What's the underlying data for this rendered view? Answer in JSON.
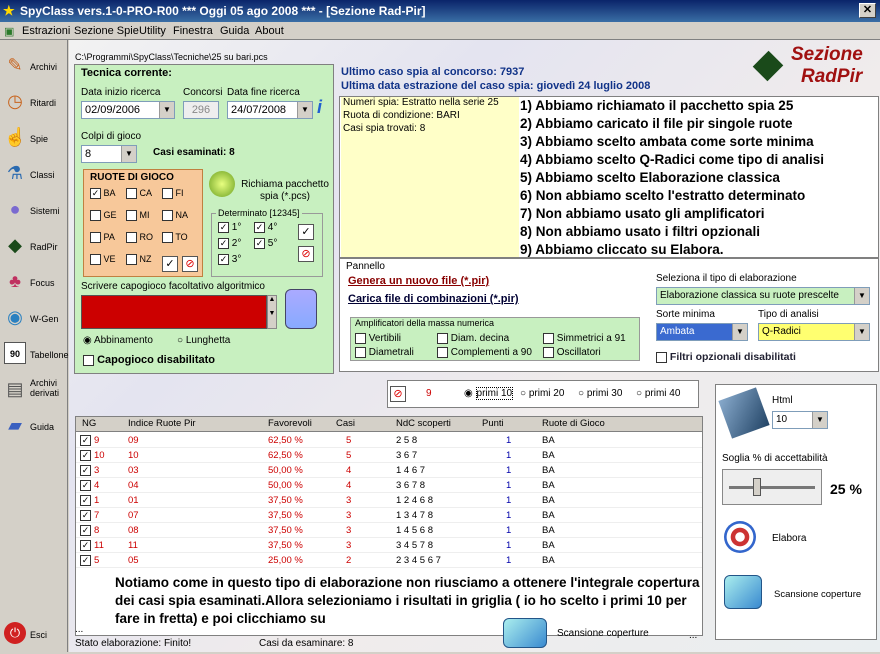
{
  "titlebar": {
    "title": "SpyClass vers.1-0-PRO-R00  ***  Oggi 05 ago 2008  ***   - [Sezione Rad-Pir]",
    "close": "✕"
  },
  "menu": [
    "Estrazioni",
    "Sezione Spie",
    "Utility",
    "Finestra",
    "Guida",
    "About"
  ],
  "sidebar": [
    {
      "label": "Archivi",
      "icon": "✎"
    },
    {
      "label": "Ritardi",
      "icon": "◷"
    },
    {
      "label": "Spie",
      "icon": "☝"
    },
    {
      "label": "Classi",
      "icon": "⚗"
    },
    {
      "label": "Sistemi",
      "icon": "●"
    },
    {
      "label": "RadPir",
      "icon": "◆"
    },
    {
      "label": "Focus",
      "icon": "♣"
    },
    {
      "label": "W-Gen",
      "icon": "◉"
    },
    {
      "label": "Tabellone",
      "icon": "90"
    },
    {
      "label": "Archivi derivati",
      "icon": "▤"
    },
    {
      "label": "Guida",
      "icon": "▰"
    },
    {
      "label": "Esci",
      "icon": "⏻"
    }
  ],
  "path": "C:\\Programmi\\SpyClass\\Tecniche\\25 su bari.pcs",
  "tecnica": {
    "title": "Tecnica corrente:",
    "data_inizio_label": "Data inizio ricerca",
    "data_inizio": "02/09/2006",
    "concorsi_label": "Concorsi",
    "concorsi": "296",
    "data_fine_label": "Data fine ricerca",
    "data_fine": "24/07/2008",
    "colpi_label": "Colpi di gioco",
    "colpi": "8",
    "casi_esaminati": "Casi esaminati: 8"
  },
  "ruote": {
    "title": "RUOTE DI GIOCO",
    "items": [
      {
        "n": "BA",
        "c": true
      },
      {
        "n": "CA",
        "c": false
      },
      {
        "n": "FI",
        "c": false
      },
      {
        "n": "GE",
        "c": false
      },
      {
        "n": "MI",
        "c": false
      },
      {
        "n": "NA",
        "c": false
      },
      {
        "n": "PA",
        "c": false
      },
      {
        "n": "RO",
        "c": false
      },
      {
        "n": "TO",
        "c": false
      },
      {
        "n": "VE",
        "c": false
      },
      {
        "n": "NZ",
        "c": false
      }
    ]
  },
  "richiama": "Richiama pacchetto spia (*.pcs)",
  "determinato": {
    "title": "Determinato [12345]",
    "items": [
      "1°",
      "4°",
      "2°",
      "5°",
      "3°"
    ]
  },
  "capogioco": {
    "label": "Scrivere capogioco facoltativo algoritmico",
    "abbinamento": "Abbinamento",
    "lunghetta": "Lunghetta",
    "disabilitato": "Capogioco disabilitato"
  },
  "header_info": {
    "ultimo_caso": "Ultimo caso spia al concorso: 7937",
    "ultima_data": "Ultima data estrazione del caso spia: giovedì 24 luglio 2008"
  },
  "logo": {
    "line1": "Sezione",
    "line2": "RadPir"
  },
  "info_box": [
    "Numeri spia: Estratto nella serie 25",
    "Ruota di condizione: BARI",
    "Casi spia trovati: 8"
  ],
  "instructions": [
    "1) Abbiamo richiamato il pacchetto spia 25",
    "2) Abbiamo caricato il file pir singole ruote",
    "3) Abbiamo scelto ambata come sorte minima",
    "4) Abbiamo scelto Q-Radici come tipo di analisi",
    "5) Abbiamo scelto Elaborazione classica",
    "6) Non abbiamo scelto l'estratto determinato",
    "7) Non abbiamo usato gli amplificatori",
    "8) Non abbiamo usato i filtri opzionali",
    "9) Abbiamo cliccato su Elabora."
  ],
  "pannello": {
    "title": "Pannello",
    "genera": "Genera un nuovo file  (*.pir)",
    "carica": "Carica file di combinazioni  (*.pir)",
    "amp_title": "Amplificatori della massa numerica",
    "amp": [
      "Vertibili",
      "Diam. decina",
      "Simmetrici a 91",
      "Diametrali",
      "Complementi a 90",
      "Oscillatori"
    ],
    "sel_tipo_label": "Seleziona il tipo di elaborazione",
    "sel_tipo": "Elaborazione classica su ruote prescelte",
    "sorte_label": "Sorte minima",
    "sorte": "Ambata",
    "tipo_label": "Tipo di analisi",
    "tipo": "Q-Radici",
    "filtri": "Filtri opzionali disabilitati"
  },
  "primi": {
    "count": "9",
    "options": [
      "primi 10",
      "primi 20",
      "primi 30",
      "primi 40"
    ]
  },
  "grid": {
    "headers": [
      "NG",
      "Indice Ruote Pir",
      "Favorevoli",
      "Casi",
      "NdC scoperti",
      "Punti",
      "Ruote di Gioco"
    ],
    "rows": [
      [
        "9",
        "09",
        "62,50 %",
        "5",
        "2 5 8",
        "1",
        "BA"
      ],
      [
        "10",
        "10",
        "62,50 %",
        "5",
        "3 6 7",
        "1",
        "BA"
      ],
      [
        "3",
        "03",
        "50,00 %",
        "4",
        "1 4 6 7",
        "1",
        "BA"
      ],
      [
        "4",
        "04",
        "50,00 %",
        "4",
        "3 6 7 8",
        "1",
        "BA"
      ],
      [
        "1",
        "01",
        "37,50 %",
        "3",
        "1 2 4 6 8",
        "1",
        "BA"
      ],
      [
        "7",
        "07",
        "37,50 %",
        "3",
        "1 3 4 7 8",
        "1",
        "BA"
      ],
      [
        "8",
        "08",
        "37,50 %",
        "3",
        "1 4 5 6 8",
        "1",
        "BA"
      ],
      [
        "11",
        "11",
        "37,50 %",
        "3",
        "3 4 5 7 8",
        "1",
        "BA"
      ],
      [
        "5",
        "05",
        "25,00 %",
        "2",
        "2 3 4 5 6 7",
        "1",
        "BA"
      ]
    ]
  },
  "note": "Notiamo come in questo tipo di elaborazione non riusciamo a ottenere l'integrale copertura dei casi spia esaminati.Allora selezioniamo i risultati in griglia ( io ho scelto i primi 10 per fare in fretta) e poi clicchiamo su",
  "scansione_bottom": "Scansione coperture",
  "right": {
    "html_label": "Html",
    "html": "10",
    "soglia_label": "Soglia % di accettabilità",
    "soglia": "25 %",
    "elabora": "Elabora",
    "scansione": "Scansione coperture"
  },
  "status": {
    "stato": "Stato elaborazione:  Finito!",
    "casi": "Casi da esaminare: 8",
    "dots": "...",
    "dots2": "..."
  }
}
